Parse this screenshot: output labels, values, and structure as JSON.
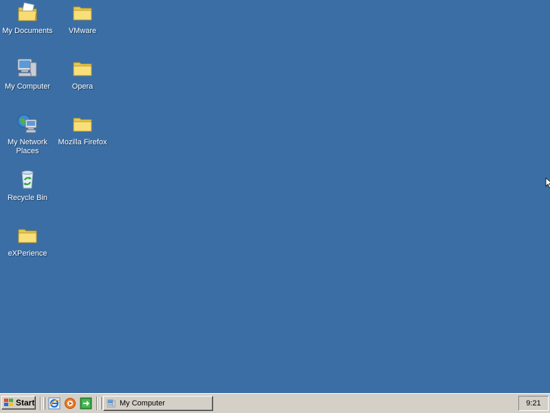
{
  "desktop": {
    "icons": [
      {
        "label": "My Documents",
        "icon": "my-documents-icon"
      },
      {
        "label": "VMware",
        "icon": "folder-icon"
      },
      {
        "label": "My Computer",
        "icon": "my-computer-icon"
      },
      {
        "label": "Opera",
        "icon": "folder-icon"
      },
      {
        "label": "My Network Places",
        "icon": "network-places-icon"
      },
      {
        "label": "Mozilla Firefox",
        "icon": "folder-icon"
      },
      {
        "label": "Recycle Bin",
        "icon": "recycle-bin-icon"
      },
      {
        "label": "eXPerience",
        "icon": "folder-icon"
      }
    ]
  },
  "taskbar": {
    "start_label": "Start",
    "quick_launch": [
      {
        "icon": "internet-explorer-icon"
      },
      {
        "icon": "media-player-icon"
      },
      {
        "icon": "show-desktop-icon"
      }
    ],
    "tasks": [
      {
        "label": "My Computer",
        "icon": "my-computer-icon"
      }
    ],
    "clock": "9:21"
  },
  "colors": {
    "desktop_background": "#3a6ea5",
    "taskbar_background": "#d4d0c8"
  }
}
